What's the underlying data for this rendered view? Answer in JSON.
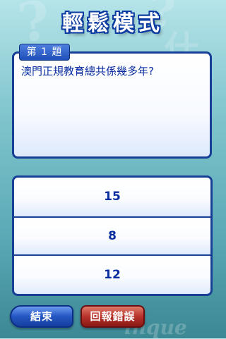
{
  "header": {
    "title": "輕鬆模式"
  },
  "question": {
    "number_label": "第 1 題",
    "text": "澳門正規教育總共係幾多年?"
  },
  "answers": [
    {
      "label": "15"
    },
    {
      "label": "8"
    },
    {
      "label": "12"
    }
  ],
  "footer": {
    "end_label": "結束",
    "report_label": "回報錯誤"
  },
  "colors": {
    "primary": "#173f96",
    "text_blue": "#0a2da0",
    "report_red": "#b7322a",
    "background_teal": "#7fc4cc"
  }
}
